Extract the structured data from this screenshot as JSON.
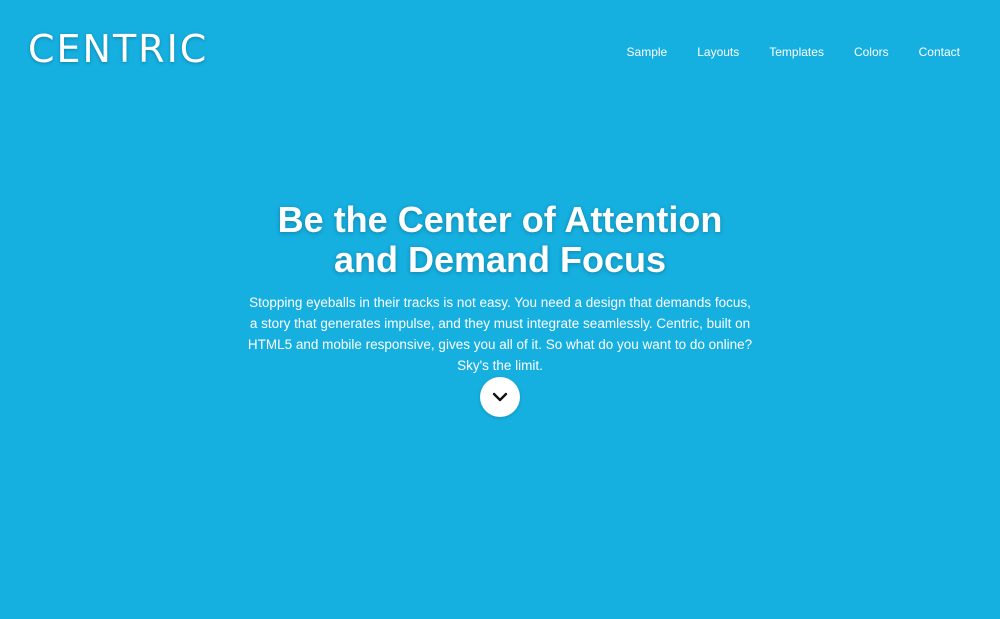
{
  "header": {
    "logo_text": "CENTRIC",
    "nav": [
      {
        "label": "Sample"
      },
      {
        "label": "Layouts"
      },
      {
        "label": "Templates"
      },
      {
        "label": "Colors"
      },
      {
        "label": "Contact"
      }
    ]
  },
  "hero": {
    "title_line1": "Be the Center of Attention",
    "title_line2": "and Demand Focus",
    "text": "Stopping eyeballs in their tracks is not easy. You need a design that demands focus, a story that generates impulse, and they must integrate seamlessly. Centric, built on HTML5 and mobile responsive, gives you all of it. So what do you want to do online? Sky's the limit.",
    "scroll_icon": "chevron-down-icon"
  },
  "colors": {
    "background": "#15afe0",
    "text": "#ffffff",
    "button_bg": "#ffffff",
    "icon": "#111111"
  }
}
